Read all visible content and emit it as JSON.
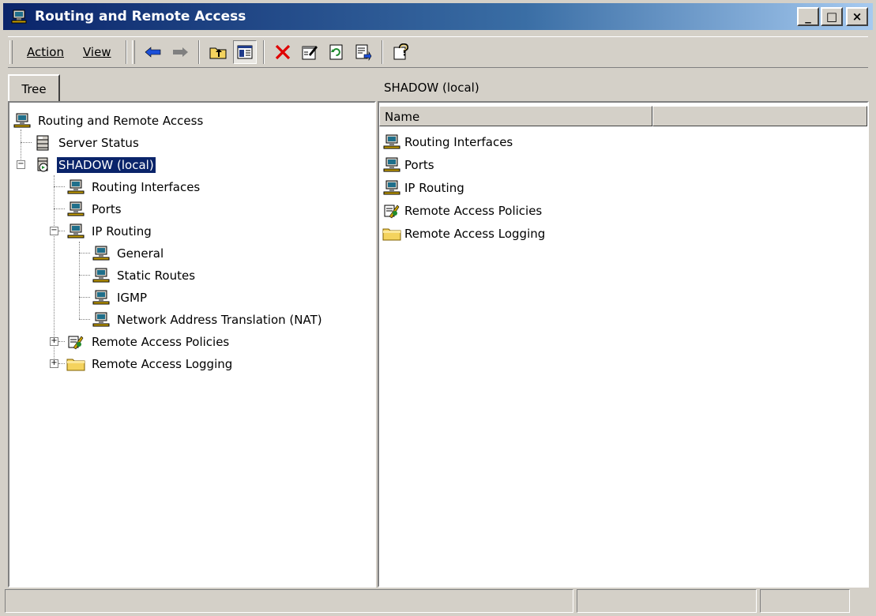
{
  "window": {
    "title": "Routing and Remote Access"
  },
  "caption": {
    "minimize": "_",
    "maximize": "□",
    "close": "×"
  },
  "menu": {
    "action": "Action",
    "view": "View"
  },
  "toolbar": {
    "buttons": [
      "back-icon",
      "forward-icon",
      "up-folder-icon",
      "show-hide-tree-icon",
      "delete-icon",
      "properties-icon",
      "refresh-icon",
      "export-list-icon",
      "help-icon"
    ]
  },
  "left": {
    "tab": "Tree"
  },
  "right": {
    "header": "SHADOW (local)",
    "column_name": "Name"
  },
  "tree": [
    {
      "label": "Routing and Remote Access"
    },
    {
      "label": "Server Status"
    },
    {
      "label": "SHADOW (local)"
    },
    {
      "label": "Routing Interfaces"
    },
    {
      "label": "Ports"
    },
    {
      "label": "IP Routing"
    },
    {
      "label": "General"
    },
    {
      "label": "Static Routes"
    },
    {
      "label": "IGMP"
    },
    {
      "label": "Network Address Translation (NAT)"
    },
    {
      "label": "Remote Access Policies"
    },
    {
      "label": "Remote Access Logging"
    }
  ],
  "list": [
    {
      "label": "Routing Interfaces"
    },
    {
      "label": "Ports"
    },
    {
      "label": "IP Routing"
    },
    {
      "label": "Remote Access Policies"
    },
    {
      "label": "Remote Access Logging"
    }
  ],
  "colors": {
    "title_start": "#0a246a",
    "title_end": "#a6caf0",
    "selection": "#0a246a",
    "delete_red": "#e00000"
  }
}
